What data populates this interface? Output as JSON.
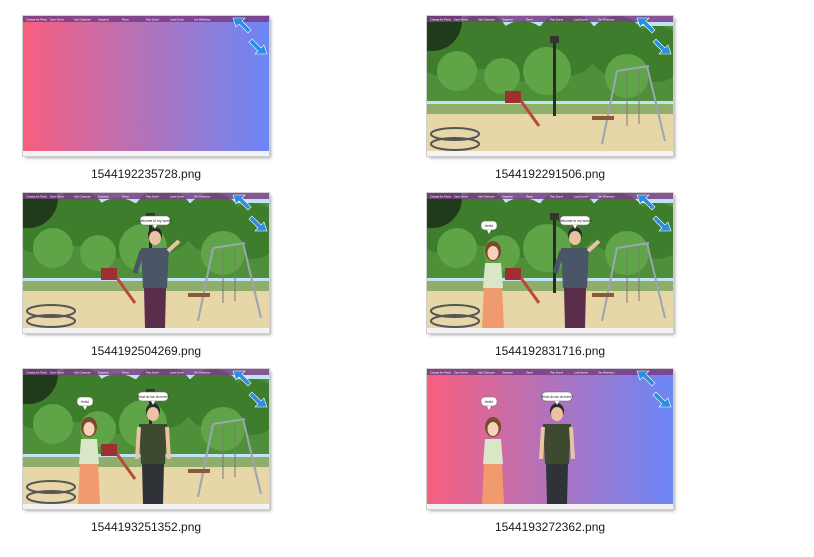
{
  "files": [
    {
      "filename": "1544192235728.png",
      "scene": "gradient",
      "characters": [],
      "bubbles": []
    },
    {
      "filename": "1544192291506.png",
      "scene": "park",
      "characters": [],
      "bubbles": []
    },
    {
      "filename": "1544192504269.png",
      "scene": "park",
      "characters": [
        "man-waving"
      ],
      "bubbles": [
        {
          "text": "Welcome to my world!",
          "who": "man"
        }
      ]
    },
    {
      "filename": "1544192831716.png",
      "scene": "park",
      "characters": [
        "woman",
        "man-waving"
      ],
      "bubbles": [
        {
          "text": "Hello!",
          "who": "woman"
        },
        {
          "text": "Welcome to my world!",
          "who": "man"
        }
      ]
    },
    {
      "filename": "1544193251352.png",
      "scene": "park",
      "characters": [
        "woman",
        "man-green"
      ],
      "bubbles": [
        {
          "text": "Hello!",
          "who": "woman"
        },
        {
          "text": "What do we do here?",
          "who": "man"
        }
      ]
    },
    {
      "filename": "1544193272362.png",
      "scene": "gradient",
      "characters": [
        "woman",
        "man-green"
      ],
      "bubbles": [
        {
          "text": "Hello!",
          "who": "woman"
        },
        {
          "text": "What do we do here?",
          "who": "man"
        }
      ]
    }
  ],
  "game_toolbar": {
    "menu_items": [
      "Change the Photo",
      "Save Scene",
      "Add Character",
      "Snapshot",
      "Reset",
      "Play Scene",
      "Load Scene",
      "Get Whatsbox"
    ]
  },
  "colors": {
    "gradient_left": "#f85f7e",
    "gradient_right": "#6b86f7",
    "toolbar_bg": "#7a3d86",
    "expand_icon": "#2b8fe0"
  },
  "icons": {
    "expand": "expand-arrows-icon"
  }
}
